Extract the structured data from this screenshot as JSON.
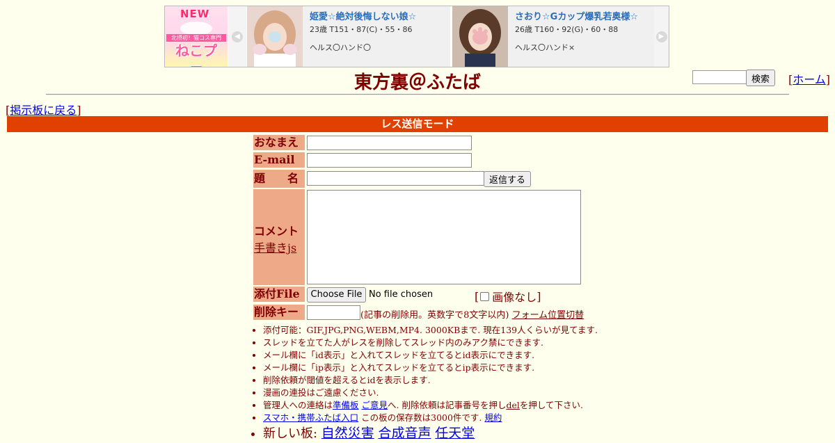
{
  "ad": {
    "logo_new": "NEW",
    "logo_sub": "北摂初！猫コス専門",
    "logo_brand": "ねこプロ",
    "cards": [
      {
        "name": "姫愛☆絶対後悔しない娘☆",
        "spec": "23歳 T151・87(C)・55・86",
        "service": "ヘルス〇ハンド〇"
      },
      {
        "name": "さおり☆Gカップ爆乳若奥様☆",
        "spec": "26歳 T160・92(G)・60・88",
        "service": "ヘルス〇ハンド×"
      }
    ]
  },
  "header": {
    "title": "東方裏＠ふたば",
    "search_button": "検索",
    "home_link": "ホーム",
    "back_link": "掲示板に戻る"
  },
  "mode": "レス送信モード",
  "form": {
    "name_label": "おなまえ",
    "email_label": "E-mail",
    "subject_label": "題　　名",
    "submit_button": "返信する",
    "comment_label": "コメント",
    "handwrite_link": "手書きjs",
    "file_label": "添付File",
    "file_button": "Choose File",
    "file_status": "No file chosen",
    "noimage_label": "画像なし",
    "delkey_label": "削除キー",
    "delkey_note": "(記事の削除用。英数字で8文字以内)",
    "form_pos_link": "フォーム位置切替"
  },
  "notes": {
    "n1": "添付可能：GIF,JPG,PNG,WEBM,MP4. 3000KBまで. 現在139人くらいが見てます.",
    "n2": "スレッドを立てた人がレスを削除してスレッド内のみアク禁にできます.",
    "n3": "メール欄に「id表示」と入れてスレッドを立てるとid表示にできます.",
    "n4": "メール欄に「ip表示」と入れてスレッドを立てるとip表示にできます.",
    "n5": "削除依頼が閾値を超えるとidを表示します.",
    "n6": "漫画の連投はご遠慮ください.",
    "n7_pre": "管理人への連絡は",
    "n7_link1": "準備板",
    "n7_link2": "ご意見",
    "n7_mid": "へ. 削除依頼は記事番号を押し",
    "n7_link3": "del",
    "n7_post": "を押して下さい.",
    "n8_link": "スマホ・携帯ふたば入口",
    "n8_text": " この板の保存数は3000件です. ",
    "n8_link2": "規約",
    "n9_label": "新しい板: ",
    "n9_links": [
      "自然災害",
      "合成音声",
      "任天堂"
    ]
  },
  "colors": {
    "background": "#ffffee",
    "text": "#800000",
    "mode_bar": "#e04000",
    "label_bg": "#eeaa88",
    "link": "#0000ee"
  }
}
